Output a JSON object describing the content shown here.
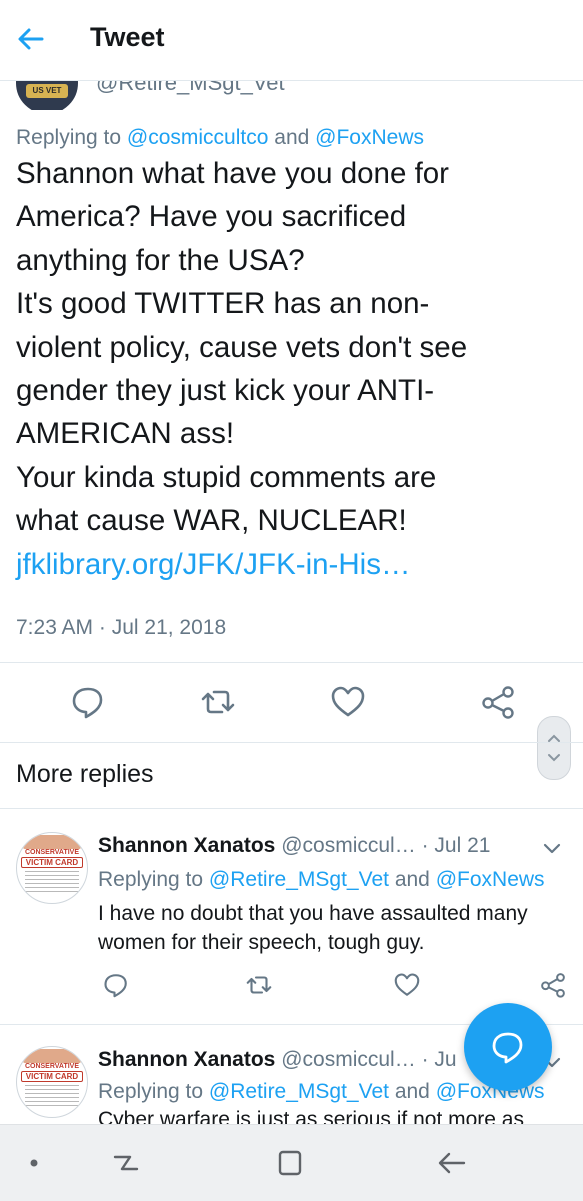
{
  "header": {
    "title": "Tweet"
  },
  "tweet": {
    "author_handle": "@Retire_MSgt_Vet",
    "replying_prefix": "Replying to",
    "replying_user1": "@cosmiccultco",
    "replying_and": "and",
    "replying_user2": "@FoxNews",
    "text_lines": [
      "Shannon what have you done for",
      "America? Have you sacrificed",
      "anything for the USA?",
      "It's good TWITTER has an non-",
      "violent policy, cause vets don't see",
      "gender they just kick your ANTI-",
      "AMERICAN ass!",
      "Your kinda stupid comments are",
      "what cause WAR, NUCLEAR!"
    ],
    "link": "jfklibrary.org/JFK/JFK-in-His…",
    "timestamp": "7:23 AM · Jul 21, 2018"
  },
  "more_replies_label": "More replies",
  "replies": [
    {
      "avatar_top": "CONSERVATIVE",
      "avatar_main": "VICTIM CARD",
      "name": "Shannon Xanatos",
      "handle": "@cosmiccul…",
      "date": "· Jul 21",
      "replying_prefix": "Replying to",
      "replying_user1": "@Retire_MSgt_Vet",
      "replying_and": "and",
      "replying_user2": "@FoxNews",
      "text_lines": [
        "I have no doubt that you have assaulted many",
        "women for their speech, tough guy."
      ]
    },
    {
      "avatar_top": "CONSERVATIVE",
      "avatar_main": "VICTIM CARD",
      "name": "Shannon Xanatos",
      "handle": "@cosmiccul…",
      "date": "· Ju",
      "replying_prefix": "Replying to",
      "replying_user1": "@Retire_MSgt_Vet",
      "replying_and": "and",
      "replying_user2": "@FoxNews",
      "text_partial": "Cyber warfare is just as serious if not more as"
    }
  ],
  "icons": {
    "back": "arrow-left-icon",
    "reply": "speech-bubble-icon",
    "retweet": "retweet-icon",
    "like": "heart-icon",
    "share": "share-icon",
    "compose": "compose-reply-icon"
  },
  "colors": {
    "accent": "#1da1f2",
    "muted": "#657786",
    "text": "#14171a"
  }
}
